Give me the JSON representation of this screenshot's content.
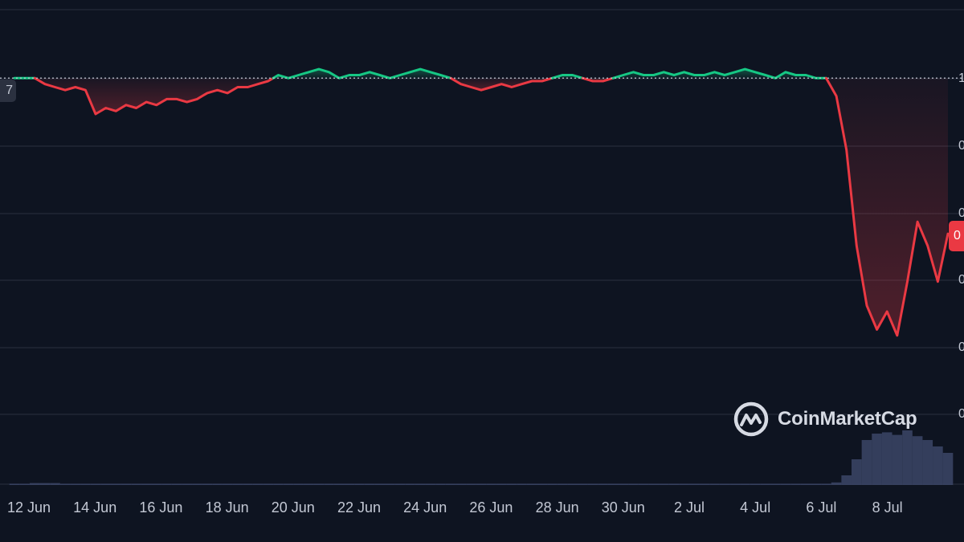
{
  "chart_data": {
    "type": "line",
    "title": "",
    "xlabel": "",
    "ylabel": "",
    "x_tick_labels": [
      "12 Jun",
      "14 Jun",
      "16 Jun",
      "18 Jun",
      "20 Jun",
      "22 Jun",
      "24 Jun",
      "26 Jun",
      "28 Jun",
      "30 Jun",
      "2 Jul",
      "4 Jul",
      "6 Jul",
      "8 Jul"
    ],
    "y_tick_labels_partial": [
      "1",
      "0",
      "0",
      "0",
      "0",
      "0"
    ],
    "reference_line_label_partial": "7",
    "current_price_label_partial": "0",
    "reference_value": 1.0,
    "ylim": [
      0.5,
      1.05
    ],
    "series": [
      {
        "values": [
          1.0,
          1.0,
          1.0,
          0.99,
          0.985,
          0.98,
          0.985,
          0.98,
          0.94,
          0.95,
          0.945,
          0.955,
          0.95,
          0.96,
          0.955,
          0.965,
          0.965,
          0.96,
          0.965,
          0.975,
          0.98,
          0.975,
          0.985,
          0.985,
          0.99,
          0.995,
          1.005,
          1.0,
          1.005,
          1.01,
          1.015,
          1.01,
          1.0,
          1.005,
          1.005,
          1.01,
          1.005,
          1.0,
          1.005,
          1.01,
          1.015,
          1.01,
          1.005,
          1.0,
          0.99,
          0.985,
          0.98,
          0.985,
          0.99,
          0.985,
          0.99,
          0.995,
          0.995,
          1.0,
          1.005,
          1.005,
          1.0,
          0.995,
          0.995,
          1.0,
          1.005,
          1.01,
          1.005,
          1.005,
          1.01,
          1.005,
          1.01,
          1.005,
          1.005,
          1.01,
          1.005,
          1.01,
          1.015,
          1.01,
          1.005,
          1.0,
          1.01,
          1.005,
          1.005,
          1.0,
          1.0,
          0.97,
          0.88,
          0.72,
          0.62,
          0.58,
          0.61,
          0.57,
          0.66,
          0.76,
          0.72,
          0.66,
          0.74
        ]
      }
    ],
    "volume": [
      0.02,
      0.02,
      0.03,
      0.03,
      0.03,
      0.02,
      0.02,
      0.02,
      0.02,
      0.02,
      0.02,
      0.02,
      0.02,
      0.02,
      0.02,
      0.02,
      0.02,
      0.02,
      0.02,
      0.02,
      0.02,
      0.02,
      0.02,
      0.02,
      0.02,
      0.02,
      0.02,
      0.02,
      0.02,
      0.02,
      0.02,
      0.02,
      0.02,
      0.02,
      0.02,
      0.02,
      0.02,
      0.02,
      0.02,
      0.02,
      0.02,
      0.02,
      0.02,
      0.02,
      0.02,
      0.02,
      0.02,
      0.02,
      0.02,
      0.02,
      0.02,
      0.02,
      0.02,
      0.02,
      0.02,
      0.02,
      0.02,
      0.02,
      0.02,
      0.02,
      0.02,
      0.02,
      0.02,
      0.02,
      0.02,
      0.02,
      0.02,
      0.02,
      0.02,
      0.02,
      0.02,
      0.02,
      0.02,
      0.02,
      0.02,
      0.02,
      0.02,
      0.02,
      0.02,
      0.02,
      0.02,
      0.04,
      0.15,
      0.4,
      0.7,
      0.8,
      0.82,
      0.78,
      0.85,
      0.76,
      0.7,
      0.6,
      0.5
    ],
    "grid": true,
    "legend": "none",
    "colors": {
      "up": "#16c784",
      "down": "#ea3943",
      "background": "#0e1421",
      "grid": "#2a3140",
      "volume": "#3b4566",
      "reference": "#c3c8d4"
    }
  },
  "watermark": {
    "text": "CoinMarketCap",
    "icon": "coinmarketcap-logo-icon"
  }
}
